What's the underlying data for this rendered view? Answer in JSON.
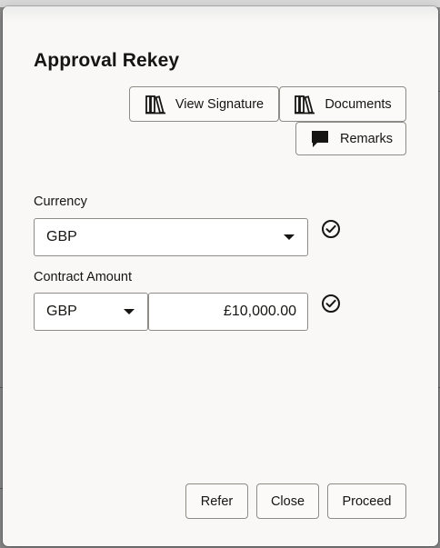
{
  "dialog": {
    "title": "Approval Rekey"
  },
  "toolbar": {
    "view_signature_label": "View Signature",
    "documents_label": "Documents",
    "remarks_label": "Remarks"
  },
  "icons": {
    "view_signature": "books-icon",
    "documents": "books-icon",
    "remarks": "chat-bubble-icon",
    "verified": "check-circle-icon"
  },
  "form": {
    "currency": {
      "label": "Currency",
      "value": "GBP"
    },
    "contract_amount": {
      "label": "Contract Amount",
      "currency": "GBP",
      "amount": "£10,000.00"
    }
  },
  "footer": {
    "refer_label": "Refer",
    "close_label": "Close",
    "proceed_label": "Proceed"
  },
  "colors": {
    "dialog_bg": "#f9f8f6",
    "border": "#8f8c87",
    "text": "#161513",
    "overlay": "#8a8a8a"
  }
}
